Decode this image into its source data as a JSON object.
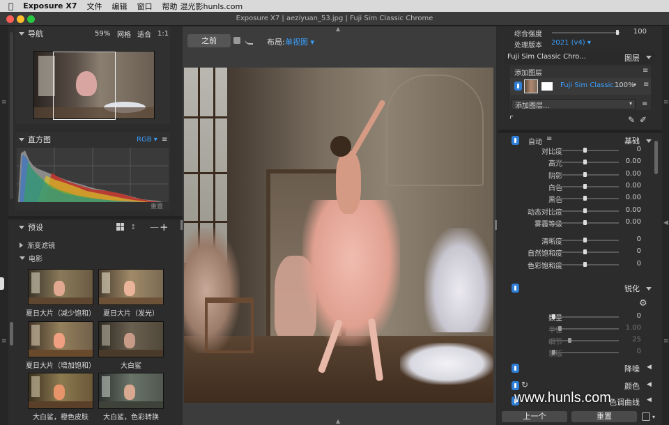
{
  "menubar": {
    "apple": "",
    "app": "Exposure X7",
    "items": [
      "文件",
      "编辑",
      "窗口",
      "帮助"
    ],
    "watermark_top": "混光影hunls.com"
  },
  "window": {
    "title": "Exposure X7 | aeziyuan_53.jpg | Fuji Sim Classic Chrome"
  },
  "navigator": {
    "title": "导航",
    "zoom_pct": "59%",
    "grid": "网格",
    "fit": "适合",
    "one_to_one": "1:1"
  },
  "histogram": {
    "title": "直方图",
    "mode": "RGB",
    "reset": "重置"
  },
  "presets": {
    "title": "预设",
    "groups": [
      {
        "label": "渐变滤镜",
        "expanded": false
      },
      {
        "label": "电影",
        "expanded": true
      }
    ],
    "thumbnails": [
      "夏日大片（减少饱和）",
      "夏日大片（发光）",
      "夏日大片（增加饱和）",
      "大白鲨",
      "大白鲨，橙色皮肤",
      "大白鲨，色彩转换"
    ]
  },
  "toolbar": {
    "before": "之前",
    "layout_label": "布局:",
    "layout_value": "单视图"
  },
  "right": {
    "overall_strength_label": "综合强度",
    "overall_strength_value": "100",
    "overall_strength_fraction": 1.0,
    "process_label": "处理版本",
    "process_value": "2021 (v4)",
    "preset_name": "Fuji Sim Classic Chro...",
    "layers_title": "图层",
    "add_layer": "添加图层",
    "layer_name": "Fuji Sim Classic...",
    "layer_opacity": "100%",
    "add_layer_dropdown": "添加图层...",
    "basic": {
      "auto": "自动",
      "title": "基础",
      "rows": [
        {
          "label": "对比度",
          "value": "0",
          "pos": 0.5
        },
        {
          "label": "高光",
          "value": "0.00",
          "pos": 0.5
        },
        {
          "label": "阴影",
          "value": "0.00",
          "pos": 0.5
        },
        {
          "label": "白色",
          "value": "0.00",
          "pos": 0.5
        },
        {
          "label": "黑色",
          "value": "0.00",
          "pos": 0.5
        },
        {
          "label": "动态对比度",
          "value": "0.00",
          "pos": 0.5
        },
        {
          "label": "雾霾等级",
          "value": "0.00",
          "pos": 0.5
        },
        {
          "label": "清晰度",
          "value": "0",
          "pos": 0.5
        },
        {
          "label": "自然饱和度",
          "value": "0",
          "pos": 0.5
        },
        {
          "label": "色彩饱和度",
          "value": "0",
          "pos": 0.5
        }
      ]
    },
    "sharpen": {
      "title": "锐化",
      "rows": [
        {
          "label": "数量",
          "value": "0",
          "pos": 0.0,
          "dim": false
        },
        {
          "label": "半径",
          "value": "1.00",
          "pos": 0.1,
          "dim": true
        },
        {
          "label": "细节",
          "value": "25",
          "pos": 0.25,
          "dim": true
        },
        {
          "label": "蒙版",
          "value": "0",
          "pos": 0.0,
          "dim": true
        }
      ]
    },
    "noise_title": "降噪",
    "color_title": "颜色",
    "curves_title": "色调曲线",
    "prev_button": "上一个",
    "reset_button": "重置"
  },
  "watermark": "www.hunls.com",
  "colors": {
    "accent": "#3aa0ff",
    "toggle": "#2f7fd6"
  }
}
